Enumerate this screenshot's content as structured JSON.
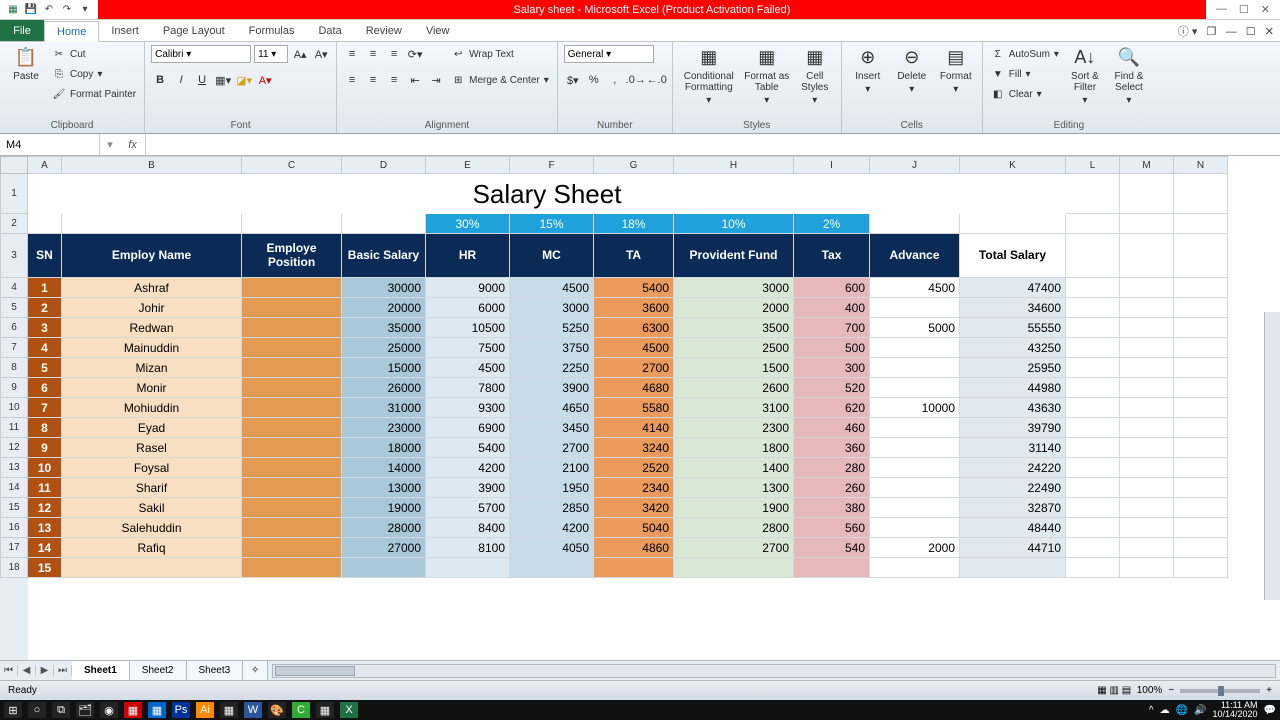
{
  "window": {
    "title": "Salary sheet  -  Microsoft Excel (Product Activation Failed)"
  },
  "tabs": {
    "file": "File",
    "list": [
      "Home",
      "Insert",
      "Page Layout",
      "Formulas",
      "Data",
      "Review",
      "View"
    ],
    "active": "Home"
  },
  "ribbon": {
    "clipboard": {
      "paste": "Paste",
      "cut": "Cut",
      "copy": "Copy",
      "painter": "Format Painter",
      "label": "Clipboard"
    },
    "font": {
      "name": "Calibri",
      "size": "11",
      "label": "Font"
    },
    "align": {
      "wrap": "Wrap Text",
      "merge": "Merge & Center",
      "label": "Alignment"
    },
    "number": {
      "format": "General",
      "label": "Number"
    },
    "styles": {
      "cond": "Conditional Formatting",
      "table": "Format as Table",
      "cell": "Cell Styles",
      "label": "Styles"
    },
    "cells": {
      "insert": "Insert",
      "delete": "Delete",
      "format": "Format",
      "label": "Cells"
    },
    "editing": {
      "autosum": "AutoSum",
      "fill": "Fill",
      "clear": "Clear",
      "sort": "Sort & Filter",
      "find": "Find & Select",
      "label": "Editing"
    }
  },
  "namebox": "M4",
  "columns": [
    "A",
    "B",
    "C",
    "D",
    "E",
    "F",
    "G",
    "H",
    "I",
    "J",
    "K",
    "L",
    "M",
    "N"
  ],
  "rows_visible": 18,
  "sheet_title": "Salary Sheet",
  "percent_row": {
    "hr": "30%",
    "mc": "15%",
    "ta": "18%",
    "pf": "10%",
    "tax": "2%"
  },
  "headers": {
    "sn": "SN",
    "name": "Employ Name",
    "pos": "Employe Position",
    "basic": "Basic Salary",
    "hr": "HR",
    "mc": "MC",
    "ta": "TA",
    "pf": "Provident Fund",
    "tax": "Tax",
    "adv": "Advance",
    "total": "Total Salary"
  },
  "data": [
    {
      "sn": "1",
      "name": "Ashraf",
      "basic": "30000",
      "hr": "9000",
      "mc": "4500",
      "ta": "5400",
      "pf": "3000",
      "tax": "600",
      "adv": "4500",
      "total": "47400"
    },
    {
      "sn": "2",
      "name": "Johir",
      "basic": "20000",
      "hr": "6000",
      "mc": "3000",
      "ta": "3600",
      "pf": "2000",
      "tax": "400",
      "adv": "",
      "total": "34600"
    },
    {
      "sn": "3",
      "name": "Redwan",
      "basic": "35000",
      "hr": "10500",
      "mc": "5250",
      "ta": "6300",
      "pf": "3500",
      "tax": "700",
      "adv": "5000",
      "total": "55550"
    },
    {
      "sn": "4",
      "name": "Mainuddin",
      "basic": "25000",
      "hr": "7500",
      "mc": "3750",
      "ta": "4500",
      "pf": "2500",
      "tax": "500",
      "adv": "",
      "total": "43250"
    },
    {
      "sn": "5",
      "name": "Mizan",
      "basic": "15000",
      "hr": "4500",
      "mc": "2250",
      "ta": "2700",
      "pf": "1500",
      "tax": "300",
      "adv": "",
      "total": "25950"
    },
    {
      "sn": "6",
      "name": "Monir",
      "basic": "26000",
      "hr": "7800",
      "mc": "3900",
      "ta": "4680",
      "pf": "2600",
      "tax": "520",
      "adv": "",
      "total": "44980"
    },
    {
      "sn": "7",
      "name": "Mohiuddin",
      "basic": "31000",
      "hr": "9300",
      "mc": "4650",
      "ta": "5580",
      "pf": "3100",
      "tax": "620",
      "adv": "10000",
      "total": "43630"
    },
    {
      "sn": "8",
      "name": "Eyad",
      "basic": "23000",
      "hr": "6900",
      "mc": "3450",
      "ta": "4140",
      "pf": "2300",
      "tax": "460",
      "adv": "",
      "total": "39790"
    },
    {
      "sn": "9",
      "name": "Rasel",
      "basic": "18000",
      "hr": "5400",
      "mc": "2700",
      "ta": "3240",
      "pf": "1800",
      "tax": "360",
      "adv": "",
      "total": "31140"
    },
    {
      "sn": "10",
      "name": "Foysal",
      "basic": "14000",
      "hr": "4200",
      "mc": "2100",
      "ta": "2520",
      "pf": "1400",
      "tax": "280",
      "adv": "",
      "total": "24220"
    },
    {
      "sn": "11",
      "name": "Sharif",
      "basic": "13000",
      "hr": "3900",
      "mc": "1950",
      "ta": "2340",
      "pf": "1300",
      "tax": "260",
      "adv": "",
      "total": "22490"
    },
    {
      "sn": "12",
      "name": "Sakil",
      "basic": "19000",
      "hr": "5700",
      "mc": "2850",
      "ta": "3420",
      "pf": "1900",
      "tax": "380",
      "adv": "",
      "total": "32870"
    },
    {
      "sn": "13",
      "name": "Salehuddin",
      "basic": "28000",
      "hr": "8400",
      "mc": "4200",
      "ta": "5040",
      "pf": "2800",
      "tax": "560",
      "adv": "",
      "total": "48440"
    },
    {
      "sn": "14",
      "name": "Rafiq",
      "basic": "27000",
      "hr": "8100",
      "mc": "4050",
      "ta": "4860",
      "pf": "2700",
      "tax": "540",
      "adv": "2000",
      "total": "44710"
    }
  ],
  "last_sn": "15",
  "sheets": [
    "Sheet1",
    "Sheet2",
    "Sheet3"
  ],
  "status": {
    "ready": "Ready",
    "zoom": "100%"
  },
  "tray": {
    "time": "11:11 AM",
    "date": "10/14/2020"
  }
}
